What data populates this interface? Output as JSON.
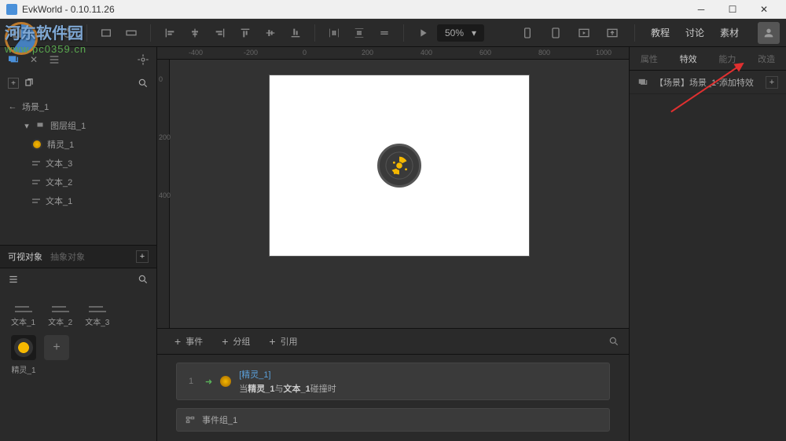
{
  "window": {
    "title": "EvkWorld - 0.10.11.26"
  },
  "toolbar": {
    "zoom": "50%",
    "nav": {
      "tutorial": "教程",
      "discuss": "讨论",
      "assets": "素材"
    }
  },
  "leftPanel": {
    "sceneBack": "场景_1",
    "tree": {
      "layerGroup": "图层组_1",
      "sprite": "精灵_1",
      "text3": "文本_3",
      "text2": "文本_2",
      "text1": "文本_1"
    },
    "objTabs": {
      "visible": "可视对象",
      "abstract": "抽象对象"
    },
    "objIcons": {
      "t1": "文本_1",
      "t2": "文本_2",
      "t3": "文本_3"
    },
    "spriteThumb": "精灵_1"
  },
  "ruler": {
    "h": [
      "-400",
      "-200",
      "0",
      "200",
      "400",
      "600",
      "800",
      "1000"
    ],
    "v": [
      "0",
      "200",
      "400"
    ]
  },
  "events": {
    "btns": {
      "event": "事件",
      "group": "分组",
      "quote": "引用"
    },
    "row1": {
      "num": "1",
      "link": "[精灵_1]",
      "textA": "当",
      "sp1": "精灵_1",
      "mid": "与",
      "sp2": "文本_1",
      "suffix": "碰撞时"
    },
    "group": "事件组_1"
  },
  "rightPanel": {
    "tabs": {
      "attr": "属性",
      "fx": "特效",
      "ability": "能力",
      "mod": "改造"
    },
    "row": "【场景】场景_1-添加特效"
  },
  "watermark": {
    "line1": "河东软件园",
    "line2": "www.pc0359.cn"
  }
}
